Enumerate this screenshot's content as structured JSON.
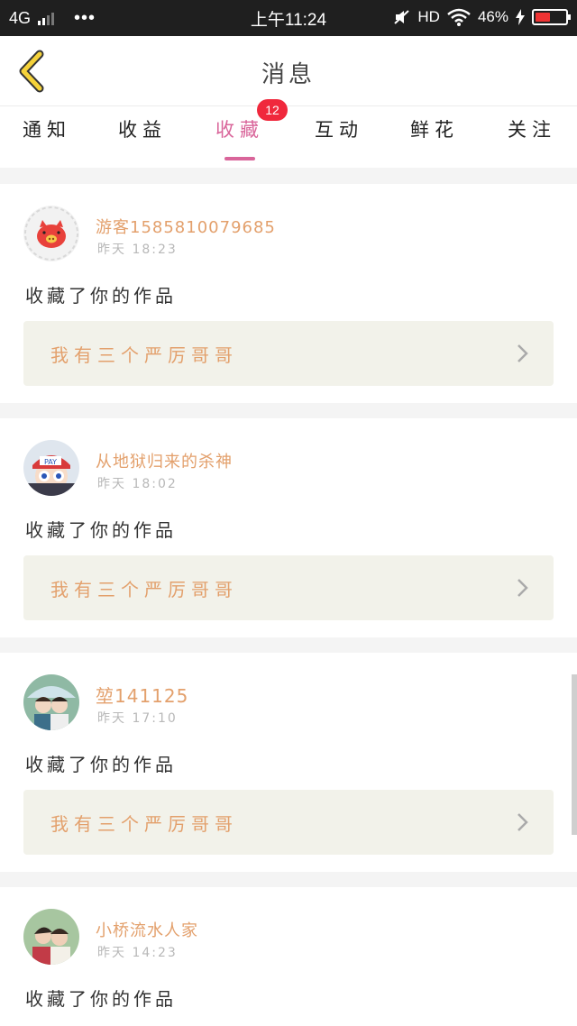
{
  "status_bar": {
    "network": "4G",
    "dots": "•••",
    "time": "上午11:24",
    "hd": "HD",
    "battery": "46%"
  },
  "header": {
    "title": "消息"
  },
  "tabs": [
    {
      "label": "通知"
    },
    {
      "label": "收益"
    },
    {
      "label": "收藏",
      "active": true,
      "badge": "12"
    },
    {
      "label": "互动"
    },
    {
      "label": "鲜花"
    },
    {
      "label": "关注"
    }
  ],
  "messages": [
    {
      "username": "游客1585810079685",
      "time": "昨天 18:23",
      "action": "收藏了你的作品",
      "work_title": "我有三个严厉哥哥",
      "avatar": "pig-avatar"
    },
    {
      "username": "从地狱归来的杀神",
      "time": "昨天 18:02",
      "action": "收藏了你的作品",
      "work_title": "我有三个严厉哥哥",
      "avatar": "cartoon-cap-avatar"
    },
    {
      "username": "堃141125",
      "time": "昨天 17:10",
      "action": "收藏了你的作品",
      "work_title": "我有三个严厉哥哥",
      "avatar": "couple-umbrella-avatar"
    },
    {
      "username": "小桥流水人家",
      "time": "昨天 14:23",
      "action": "收藏了你的作品",
      "avatar": "couple-photo-avatar"
    }
  ],
  "colors": {
    "accent": "#d9659a",
    "username": "#e3a06c",
    "badge": "#f0283c",
    "work_bg": "#f2f2ea"
  }
}
